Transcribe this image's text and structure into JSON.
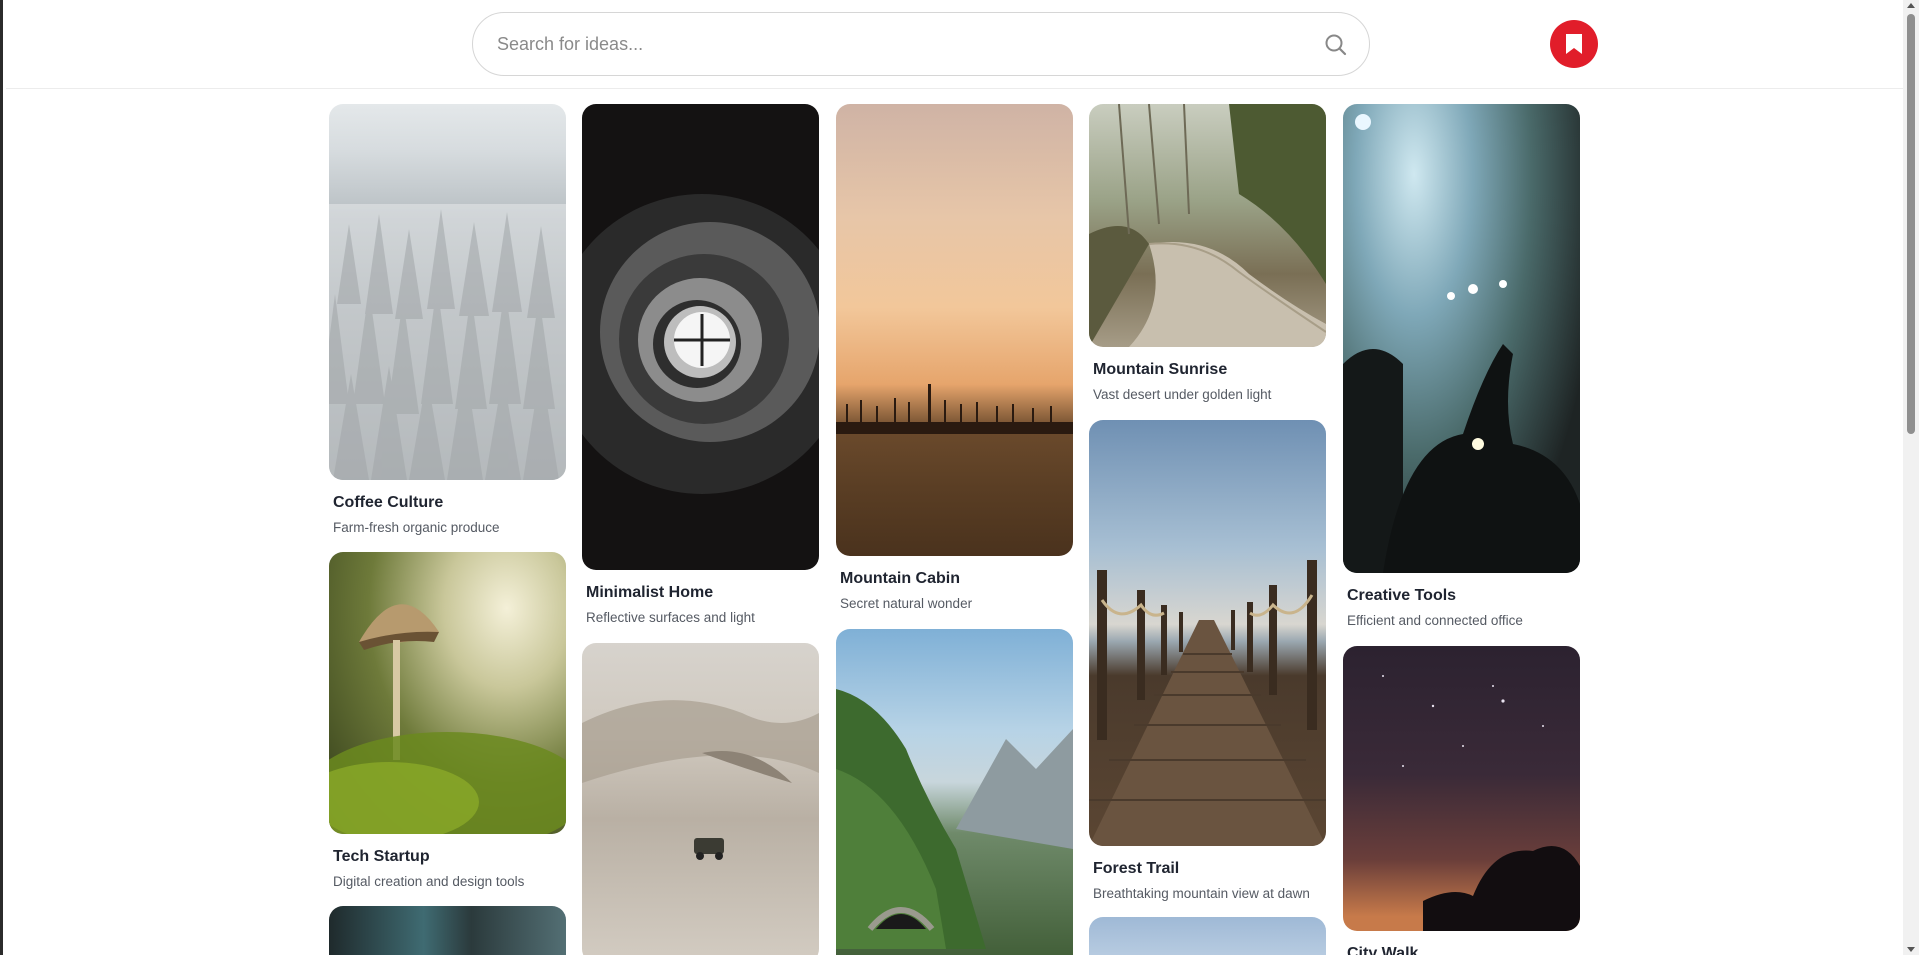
{
  "search": {
    "placeholder": "Search for ideas...",
    "icon": "search-icon"
  },
  "header": {
    "saved_button_icon": "bookmark-icon",
    "accent_color": "#e11d2a"
  },
  "pins": [
    {
      "title": "Coffee Culture",
      "description": "Farm-fresh organic produce",
      "image": "snowy pine forest"
    },
    {
      "title": "Tech Startup",
      "description": "Digital creation and design tools",
      "image": "mushroom on moss"
    },
    {
      "title": "",
      "description": "",
      "image": "forest trees"
    },
    {
      "title": "Minimalist Home",
      "description": "Reflective surfaces and light",
      "image": "spiral staircase"
    },
    {
      "title": "",
      "description": "",
      "image": "desert dunes with vehicle"
    },
    {
      "title": "Mountain Cabin",
      "description": "Secret natural wonder",
      "image": "sunset field"
    },
    {
      "title": "",
      "description": "",
      "image": "mountain valley with stone arch"
    },
    {
      "title": "Mountain Sunrise",
      "description": "Vast desert under golden light",
      "image": "forest road"
    },
    {
      "title": "Forest Trail",
      "description": "Breathtaking mountain view at dawn",
      "image": "wooden pier"
    },
    {
      "title": "",
      "description": "",
      "image": "sky"
    },
    {
      "title": "Creative Tools",
      "description": "Efficient and connected office",
      "image": "concert crowd"
    },
    {
      "title": "City Walk",
      "description": "",
      "image": "starry night sky"
    }
  ]
}
